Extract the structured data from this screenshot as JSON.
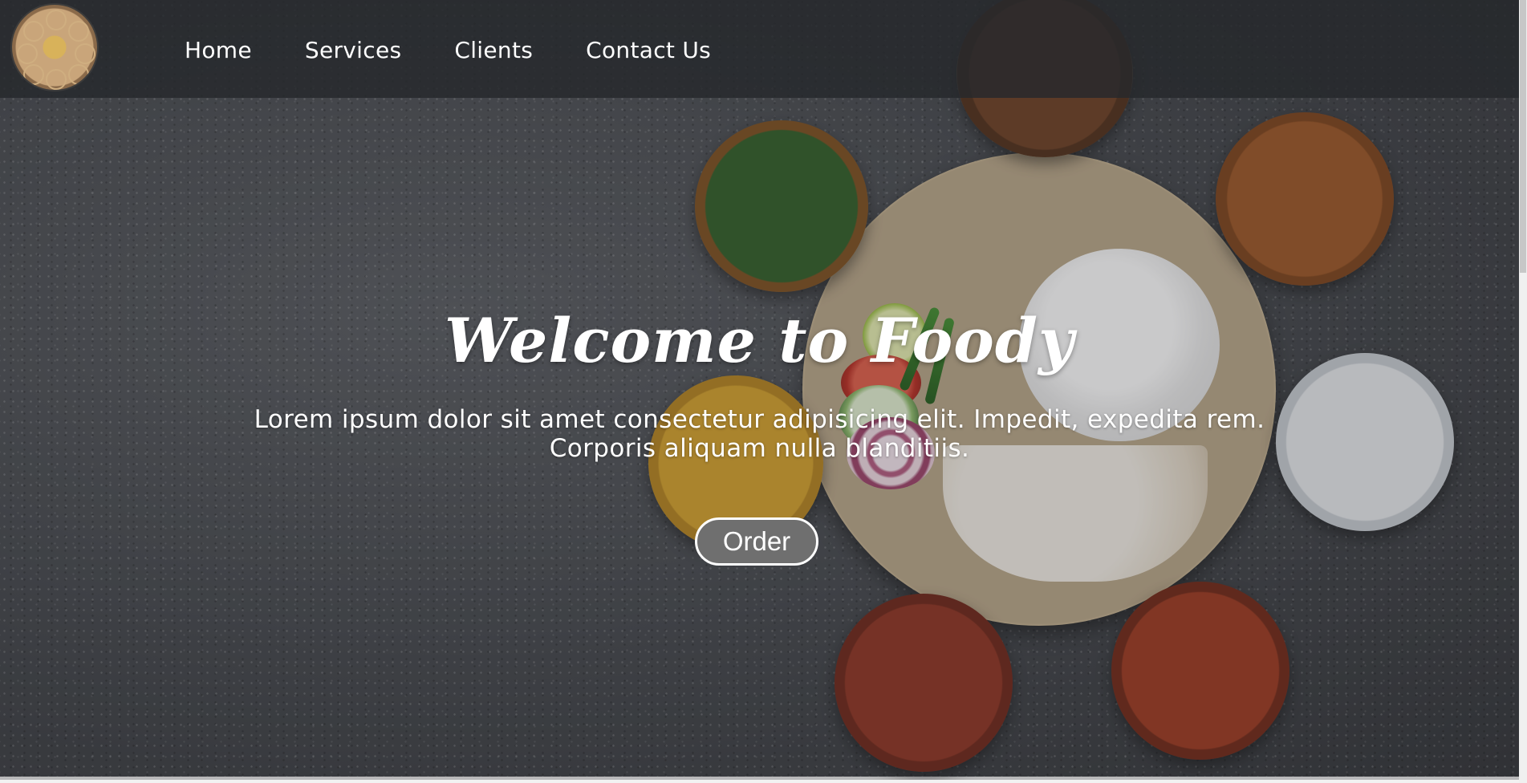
{
  "nav": {
    "logo_alt": "Foody logo",
    "links": [
      {
        "label": "Home"
      },
      {
        "label": "Services"
      },
      {
        "label": "Clients"
      },
      {
        "label": "Contact Us"
      }
    ]
  },
  "hero": {
    "title": "Welcome to Foody",
    "text": "Lorem ipsum dolor sit amet consectetur adipisicing elit. Impedit, expedita rem. Corporis aliquam nulla blanditiis.",
    "button_label": "Order"
  },
  "colors": {
    "nav_bg": "#26282c",
    "button_bg": "#6f6f6f",
    "text": "#ffffff"
  }
}
